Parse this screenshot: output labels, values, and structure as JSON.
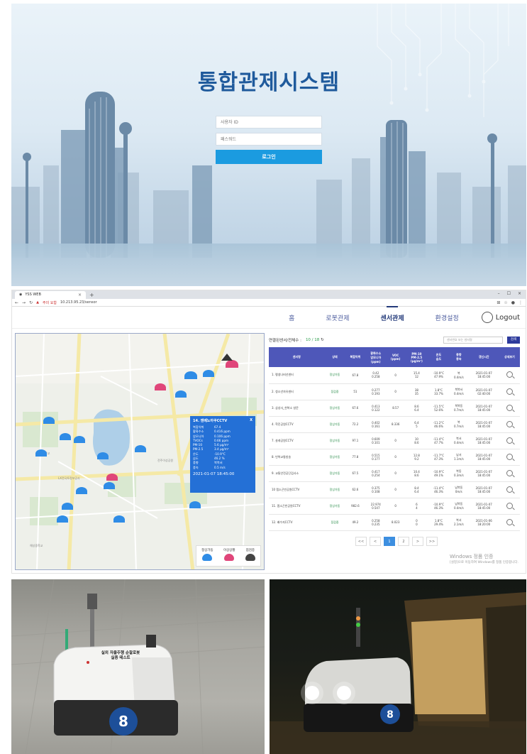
{
  "login": {
    "title": "통합관제시스템",
    "id_placeholder": "사용자 ID",
    "pw_placeholder": "패스워드",
    "button": "로그인"
  },
  "browser": {
    "tab_title": "YSS WEB",
    "address_warning": "주의 요함",
    "url": "10.213.95.23/sensor"
  },
  "nav": {
    "items": [
      "홈",
      "로봇관제",
      "센서관제",
      "환경설정"
    ],
    "active": "센서관제",
    "logout": "Logout"
  },
  "map": {
    "popup": {
      "title": "14. 엔베노아쿠CCTV",
      "close": "X",
      "rows": [
        {
          "k": "복합악취",
          "v": "67.4"
        },
        {
          "k": "황화수소",
          "v": "0.416 ppm"
        },
        {
          "k": "암모니아",
          "v": "0.106 ppm"
        },
        {
          "k": "TVOCs",
          "v": "0.66 ppm"
        },
        {
          "k": "PM-10",
          "v": "5.6 μg/m³"
        },
        {
          "k": "PM-2.5",
          "v": "3.4 μg/m³"
        },
        {
          "k": "온도",
          "v": "-10.9°C"
        },
        {
          "k": "습도",
          "v": "46.2 %"
        },
        {
          "k": "풍향",
          "v": "북북서"
        },
        {
          "k": "풍속",
          "v": "0.5 m/s"
        }
      ],
      "time": "2021-01-07 18:45:00"
    },
    "legend": [
      "정상가동",
      "이상상황",
      "점검중"
    ],
    "colors": {
      "normal": "#2f8ce6",
      "alert": "#e0467a",
      "check": "#444444"
    }
  },
  "sensor": {
    "count_label": "연결된센서/전체수 :",
    "count_value": "10 / 18",
    "search_placeholder": "센서번호 또는 센서명",
    "search_button": "검색",
    "columns": [
      "센서명",
      "상태",
      "복합악취",
      "황화수소\n암모니아\n(ppm)",
      "VOC\n(ppm)",
      "PM-10\nPM-2.5\n(μg/m³)",
      "온도\n습도",
      "풍향\n풍속",
      "갱신시간",
      "상세보기"
    ],
    "rows": [
      {
        "name": "1. 평생나비선센터",
        "state": "정상가동",
        "odor": "67.8",
        "gas": "0.42\n0.258",
        "voc": "0",
        "pm": "15.4\n12",
        "temp": "-10.9°C\n47.9%",
        "wind": "북\n0.4m/s",
        "time": "2021-01-07\n18:45:00"
      },
      {
        "name": "2. 청소년자유센터",
        "state": "점검중",
        "odor": "51",
        "gas": "0.277\n0.193",
        "voc": "0",
        "pm": "38\n35",
        "temp": "1.8°C\n33.7%",
        "wind": "북북서\n0.4m/s",
        "time": "2021-01-07\n02:40:00"
      },
      {
        "name": "3. 삼성사_천북소 방문",
        "state": "정상가동",
        "odor": "67.6",
        "gas": "0.413\n0.122",
        "voc": "8.57",
        "pm": "8.6\n6.4",
        "temp": "-11.5°C\n52.6%",
        "wind": "북북동\n0.7m/s",
        "time": "2021-01-07\n18:45:00"
      },
      {
        "name": "4. 학진공원CCTV",
        "state": "정상가동",
        "odor": "72.2",
        "gas": "0.402\n0.161",
        "voc": "8.336",
        "pm": "6.4\n5",
        "temp": "-11.2°C\n46.6%",
        "wind": "북\n0.7m/s",
        "time": "2021-01-07\n18:45:00"
      },
      {
        "name": "7. 살레공원CCTV",
        "state": "정상가동",
        "odor": "97.1",
        "gas": "0.609\n0.101",
        "voc": "0",
        "pm": "10\n8.6",
        "temp": "-11.4°C\n47.7%",
        "wind": "북서\n0.4m/s",
        "time": "2021-01-07\n18:45:00"
      },
      {
        "name": "8. 빈북교통방송",
        "state": "정상가동",
        "odor": "77.8",
        "gas": "0.515\n0.177",
        "voc": "0",
        "pm": "12.8\n9.2",
        "temp": "-11.7°C\n47.3%",
        "wind": "남서\n1.1m/s",
        "time": "2021-01-07\n18:45:00"
      },
      {
        "name": "9. 교통안전공단검사소",
        "state": "정상가동",
        "odor": "67.5",
        "gas": "0.417\n0.254",
        "voc": "0",
        "pm": "10.4\n8.6",
        "temp": "-10.9°C\n49.1%",
        "wind": "북동\n0.3m/s",
        "time": "2021-01-07\n18:45:00"
      },
      {
        "name": "10 랩소곤빈공원CCTV",
        "state": "정상가동",
        "odor": "62.6",
        "gas": "0.375\n0.108",
        "voc": "0",
        "pm": "8.4\n6.4",
        "temp": "-11.4°C\n46.3%",
        "wind": "남북동\n0m/s",
        "time": "2021-01-07\n18:45:00"
      },
      {
        "name": "11. 랩소곤빈공원CCTV",
        "state": "정상가동",
        "odor": "982.6",
        "gas": "22.974\n0.547",
        "voc": "0",
        "pm": "6\n4",
        "temp": "-10.9°C\n46.3%",
        "wind": "남북동\n0.4m/s",
        "time": "2021-01-07\n18:45:00"
      },
      {
        "name": "12. 배수지CCTV",
        "state": "점검중",
        "odor": "49.2",
        "gas": "0.258\n0.235",
        "voc": "8.023",
        "pm": "0\n0",
        "temp": "1.8°C\n29.4%",
        "wind": "북서\n2.1m/s",
        "time": "2021-01-06\n18:20:00"
      }
    ],
    "pager": [
      "<<",
      "<",
      "1",
      "2",
      ">",
      ">>"
    ],
    "pager_active": "1",
    "watermark_1": "Windows 정품 인증",
    "watermark_2": "[설정]으로 이동하여 Windows를 정품 인증합니다."
  },
  "photos": {
    "robot_label": "실외 자율주행 순찰로봇\n실증 테스트"
  }
}
